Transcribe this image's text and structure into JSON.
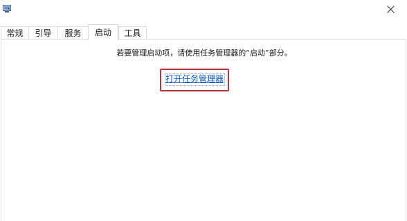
{
  "window": {
    "icon": "msconfig-app-icon",
    "close_icon": "close-icon"
  },
  "tabs": [
    {
      "label": "常规",
      "active": false
    },
    {
      "label": "引导",
      "active": false
    },
    {
      "label": "服务",
      "active": false
    },
    {
      "label": "启动",
      "active": true
    },
    {
      "label": "工具",
      "active": false
    }
  ],
  "startup": {
    "message": "若要管理启动项，请使用任务管理器的“启动”部分。",
    "link_label": "打开任务管理器",
    "highlight_color": "#b8353d",
    "link_color": "#0b59c4"
  }
}
